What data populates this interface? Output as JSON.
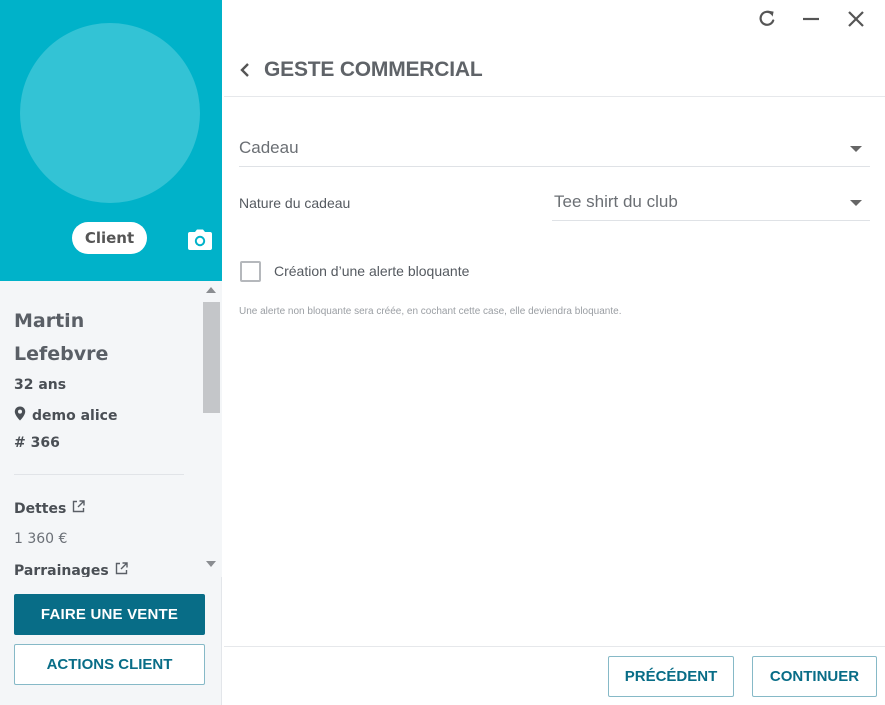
{
  "window": {
    "controls": {
      "refresh_icon": "refresh-icon",
      "minimize_icon": "minimize-icon",
      "close_icon": "close-icon"
    }
  },
  "client": {
    "badge": "Client",
    "first_name": "Martin",
    "last_name": "Lefebvre",
    "age": "32 ans",
    "location": "demo alice",
    "number": "# 366",
    "debts_label": "Dettes",
    "debts_amount": "1 360 €",
    "sponsorship_label": "Parrainages"
  },
  "sidebar_actions": {
    "primary": "FAIRE UNE VENTE",
    "secondary": "ACTIONS CLIENT"
  },
  "main": {
    "title": "GESTE COMMERCIAL",
    "gift_select": {
      "value": "Cadeau"
    },
    "gift_nature": {
      "label": "Nature du cadeau",
      "value": "Tee shirt du club"
    },
    "blocking_alert": {
      "label": "Création d’une alerte bloquante",
      "checked": false,
      "hint": "Une alerte non bloquante sera créée, en cochant cette case, elle deviendra bloquante."
    }
  },
  "footer": {
    "previous": "PRÉCÉDENT",
    "continue": "CONTINUER"
  },
  "colors": {
    "header_teal": "#00b2c9",
    "avatar_circle": "#33c3d5",
    "primary_button": "#086d87",
    "accent_text": "#086d87"
  }
}
